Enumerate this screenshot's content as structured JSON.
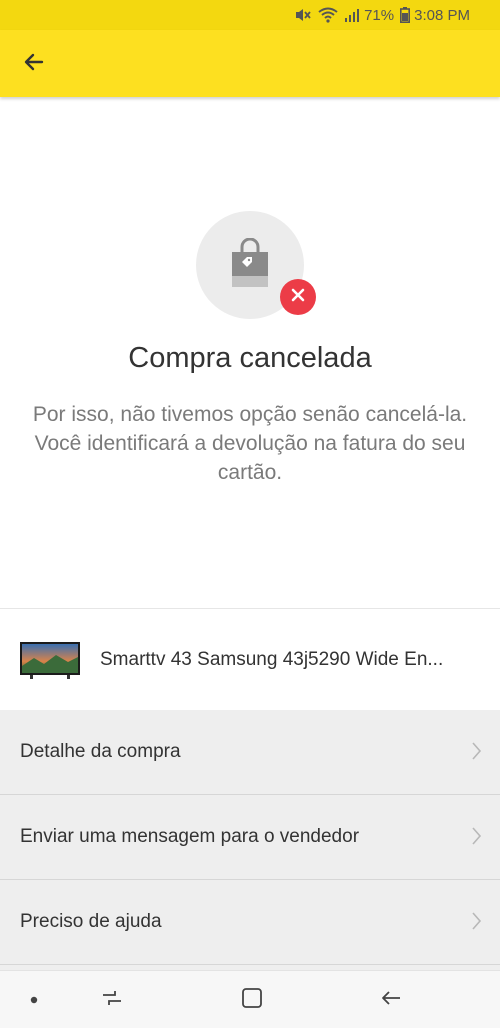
{
  "status_bar": {
    "battery_percent": "71%",
    "time": "3:08 PM",
    "icons": [
      "mute-icon",
      "wifi-icon",
      "signal-icon",
      "battery-icon"
    ]
  },
  "app_bar": {
    "back_icon": "arrow-left-icon",
    "color": "#fde020"
  },
  "hero": {
    "icon": "shopping-bag-icon",
    "badge_icon": "close-icon",
    "badge_color": "#ec3c47",
    "title": "Compra cancelada",
    "message": "Por isso, não tivemos opção senão cancelá-la. Você identificará a devolução na fatura do seu cartão."
  },
  "product": {
    "thumbnail": "tv-thumbnail",
    "title": "Smarttv 43 Samsung 43j5290 Wide En..."
  },
  "menu": {
    "items": [
      {
        "label": "Detalhe da compra"
      },
      {
        "label": "Enviar uma mensagem para o vendedor"
      },
      {
        "label": "Preciso de ajuda"
      }
    ]
  },
  "nav_bar": {
    "buttons": [
      "dot-icon",
      "recents-icon",
      "home-icon",
      "back-icon"
    ]
  }
}
